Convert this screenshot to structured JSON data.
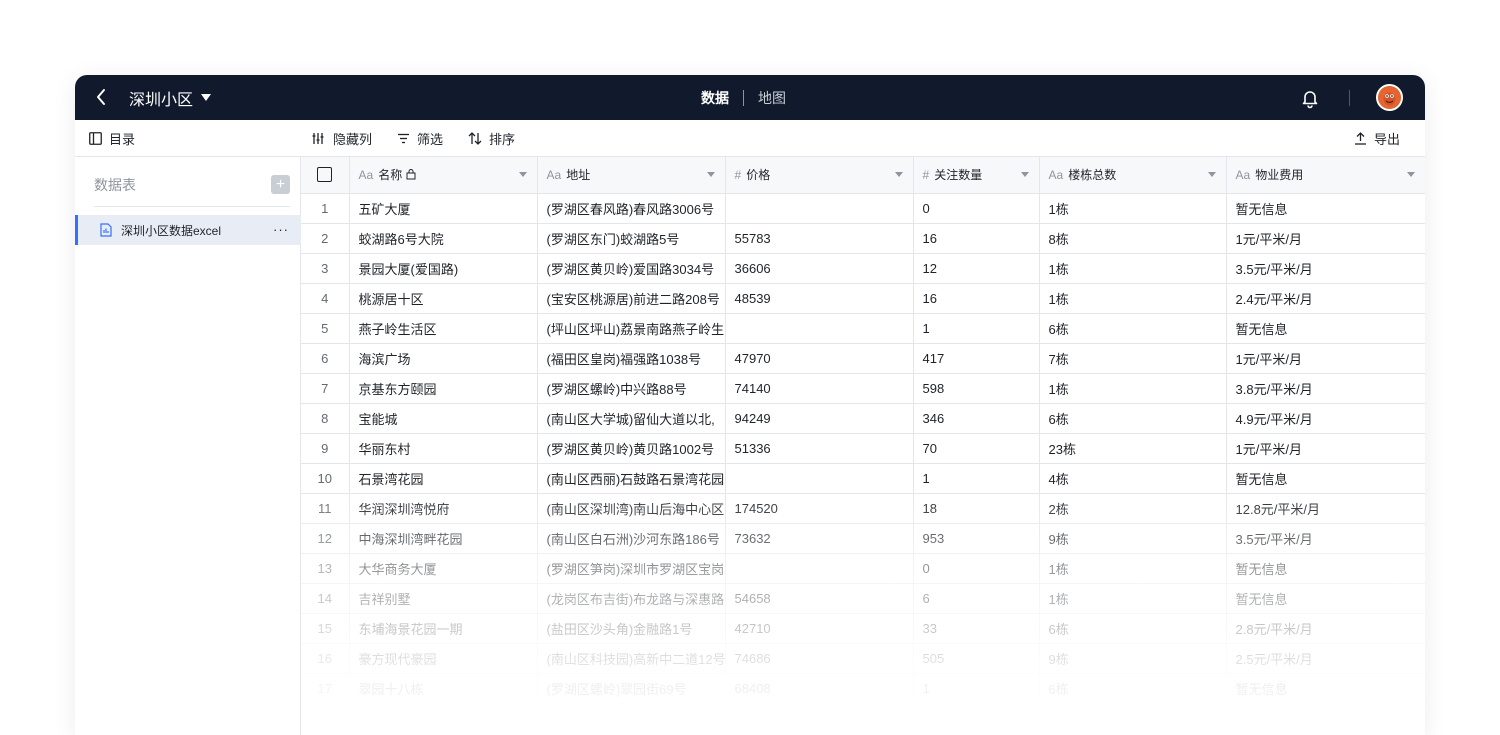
{
  "header": {
    "title": "深圳小区",
    "tabs": [
      {
        "label": "数据",
        "active": true
      },
      {
        "label": "地图",
        "active": false
      }
    ]
  },
  "toolbar": {
    "sidebar_toggle": "目录",
    "hide_columns": "隐藏列",
    "filter": "筛选",
    "sort": "排序",
    "export": "导出"
  },
  "sidebar": {
    "heading": "数据表",
    "add_label": "+",
    "items": [
      {
        "label": "深圳小区数据excel",
        "more": "···"
      }
    ]
  },
  "table": {
    "columns": [
      {
        "type": "Aa",
        "label": "名称"
      },
      {
        "type": "Aa",
        "label": "地址"
      },
      {
        "type": "#",
        "label": "价格"
      },
      {
        "type": "#",
        "label": "关注数量"
      },
      {
        "type": "Aa",
        "label": "楼栋总数"
      },
      {
        "type": "Aa",
        "label": "物业费用"
      }
    ],
    "rows": [
      {
        "idx": "1",
        "cells": [
          "五矿大厦",
          "(罗湖区春风路)春风路3006号",
          "",
          "0",
          "1栋",
          "暂无信息"
        ]
      },
      {
        "idx": "2",
        "cells": [
          "蛟湖路6号大院",
          "(罗湖区东门)蛟湖路5号",
          "55783",
          "16",
          "8栋",
          "1元/平米/月"
        ]
      },
      {
        "idx": "3",
        "cells": [
          "景园大厦(爱国路)",
          "(罗湖区黄贝岭)爱国路3034号",
          "36606",
          "12",
          "1栋",
          "3.5元/平米/月"
        ]
      },
      {
        "idx": "4",
        "cells": [
          "桃源居十区",
          "(宝安区桃源居)前进二路208号",
          "48539",
          "16",
          "1栋",
          "2.4元/平米/月"
        ]
      },
      {
        "idx": "5",
        "cells": [
          "燕子岭生活区",
          "(坪山区坪山)荔景南路燕子岭生",
          "",
          "1",
          "6栋",
          "暂无信息"
        ]
      },
      {
        "idx": "6",
        "cells": [
          "海滨广场",
          "(福田区皇岗)福强路1038号",
          "47970",
          "417",
          "7栋",
          "1元/平米/月"
        ]
      },
      {
        "idx": "7",
        "cells": [
          "京基东方颐园",
          "(罗湖区螺岭)中兴路88号",
          "74140",
          "598",
          "1栋",
          "3.8元/平米/月"
        ]
      },
      {
        "idx": "8",
        "cells": [
          "宝能城",
          "(南山区大学城)留仙大道以北,",
          "94249",
          "346",
          "6栋",
          "4.9元/平米/月"
        ]
      },
      {
        "idx": "9",
        "cells": [
          "华丽东村",
          "(罗湖区黄贝岭)黄贝路1002号",
          "51336",
          "70",
          "23栋",
          "1元/平米/月"
        ]
      },
      {
        "idx": "10",
        "cells": [
          "石景湾花园",
          "(南山区西丽)石鼓路石景湾花园",
          "",
          "1",
          "4栋",
          "暂无信息"
        ]
      },
      {
        "idx": "11",
        "cells": [
          "华润深圳湾悦府",
          "(南山区深圳湾)南山后海中心区",
          "174520",
          "18",
          "2栋",
          "12.8元/平米/月"
        ]
      },
      {
        "idx": "12",
        "cells": [
          "中海深圳湾畔花园",
          "(南山区白石洲)沙河东路186号",
          "73632",
          "953",
          "9栋",
          "3.5元/平米/月"
        ]
      },
      {
        "idx": "13",
        "cells": [
          "大华商务大厦",
          "(罗湖区笋岗)深圳市罗湖区宝岗",
          "",
          "0",
          "1栋",
          "暂无信息"
        ]
      },
      {
        "idx": "14",
        "cells": [
          "吉祥别墅",
          "(龙岗区布吉街)布龙路与深惠路",
          "54658",
          "6",
          "1栋",
          "暂无信息"
        ]
      },
      {
        "idx": "15",
        "cells": [
          "东埔海景花园一期",
          "(盐田区沙头角)金融路1号",
          "42710",
          "33",
          "6栋",
          "2.8元/平米/月"
        ]
      },
      {
        "idx": "16",
        "cells": [
          "豪方现代豪园",
          "(南山区科技园)高新中二道12号",
          "74686",
          "505",
          "9栋",
          "2.5元/平米/月"
        ]
      },
      {
        "idx": "17",
        "cells": [
          "翠园十八栋",
          "(罗湖区螺岭)翠园街69号",
          "68408",
          "1",
          "6栋",
          "暂无信息"
        ]
      }
    ]
  }
}
